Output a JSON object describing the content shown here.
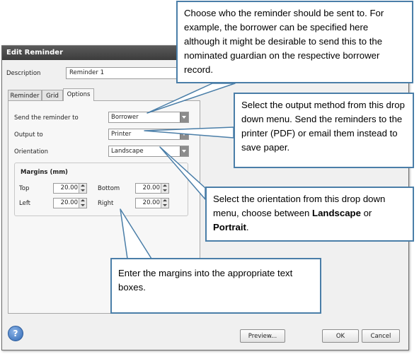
{
  "dialog": {
    "title": "Edit Reminder",
    "description_label": "Description",
    "description_value": "Reminder 1",
    "tabs": [
      {
        "label": "Reminder",
        "active": false
      },
      {
        "label": "Grid",
        "active": false
      },
      {
        "label": "Options",
        "active": true
      }
    ],
    "options": {
      "send_label": "Send the reminder to",
      "send_value": "Borrower",
      "output_label": "Output to",
      "output_value": "Printer",
      "orientation_label": "Orientation",
      "orientation_value": "Landscape"
    },
    "margins": {
      "title": "Margins (mm)",
      "top_label": "Top",
      "top_value": "20.00",
      "bottom_label": "Bottom",
      "bottom_value": "20.00",
      "left_label": "Left",
      "left_value": "20.00",
      "right_label": "Right",
      "right_value": "20.00"
    },
    "buttons": {
      "help_icon": "?",
      "preview": "Preview...",
      "ok": "OK",
      "cancel": "Cancel"
    }
  },
  "callouts": {
    "recipient": "Choose who the reminder should be sent to. For example, the borrower can be specified here although it might be desirable to send this to the nominated guardian on the respective borrower record.",
    "output": "Select the output method from this drop down menu. Send the reminders to the printer (PDF) or email them instead to save paper.",
    "orientation_pre": "Select the orientation from this drop down menu, choose between ",
    "orientation_landscape": "Landscape",
    "orientation_or": " or ",
    "orientation_portrait": "Portrait",
    "orientation_end": ".",
    "margins": "Enter the margins into the appropriate text boxes."
  },
  "colors": {
    "callout_border": "#4a7ea8",
    "titlebar": "#3c3c3c",
    "dialog_bg": "#f0f0f0"
  }
}
